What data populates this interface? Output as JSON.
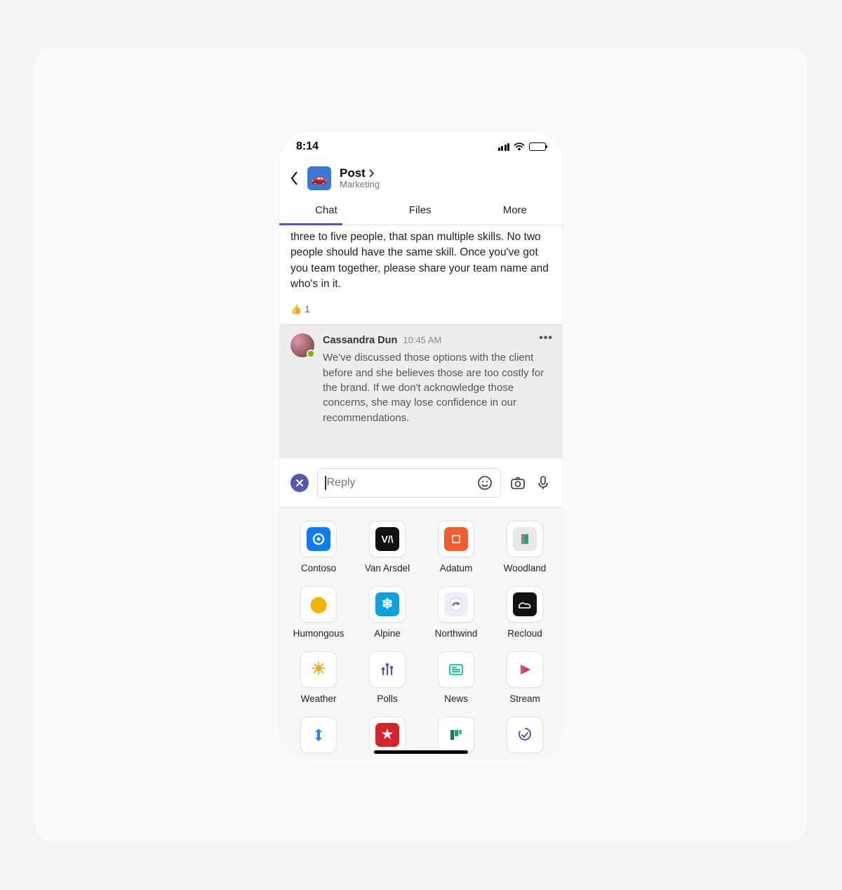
{
  "status": {
    "time": "8:14"
  },
  "header": {
    "title": "Post",
    "subtitle": "Marketing",
    "icon_emoji": "🚗"
  },
  "tabs": {
    "items": [
      "Chat",
      "Files",
      "More"
    ],
    "active": "Chat"
  },
  "message1": {
    "text": "three to five people, that span multiple skills. No two people should have the same skill. Once you've got you team together, please share your team name and who's in it.",
    "reaction_emoji": "👍",
    "reaction_count": "1"
  },
  "message2": {
    "author": "Cassandra Dun",
    "time": "10:45 AM",
    "text": "We've discussed those options with the client before and she believes those are too costly for the brand. If we don't acknowledge those concerns, she may lose confidence in our recommendations.",
    "more": "•••"
  },
  "compose": {
    "placeholder": "Reply"
  },
  "apps": [
    {
      "label": "Contoso",
      "icon": "contoso"
    },
    {
      "label": "Van Arsdel",
      "icon": "van"
    },
    {
      "label": "Adatum",
      "icon": "adatum"
    },
    {
      "label": "Woodland",
      "icon": "woodland"
    },
    {
      "label": "Humongous",
      "icon": "humongous"
    },
    {
      "label": "Alpine",
      "icon": "alpine"
    },
    {
      "label": "Northwind",
      "icon": "northwind"
    },
    {
      "label": "Recloud",
      "icon": "recloud"
    },
    {
      "label": "Weather",
      "icon": "weather"
    },
    {
      "label": "Polls",
      "icon": "polls"
    },
    {
      "label": "News",
      "icon": "news"
    },
    {
      "label": "Stream",
      "icon": "stream"
    },
    {
      "label": "",
      "icon": "jira"
    },
    {
      "label": "",
      "icon": "wunderlist"
    },
    {
      "label": "",
      "icon": "planner"
    },
    {
      "label": "",
      "icon": "todo"
    }
  ]
}
